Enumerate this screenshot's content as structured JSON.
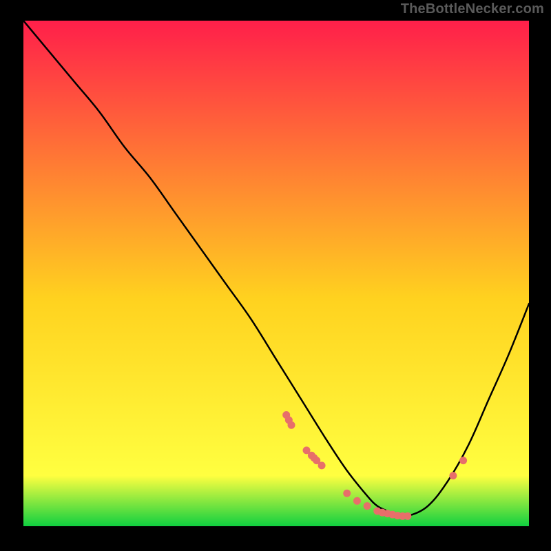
{
  "watermark": "TheBottleNecker.com",
  "colors": {
    "black": "#000000",
    "curve": "#000000",
    "marker": "#e76f6a",
    "grad_top": "#ff1f4a",
    "grad_mid": "#ffd21f",
    "grad_bot1": "#ffff40",
    "grad_bot2": "#10d040"
  },
  "chart_data": {
    "type": "line",
    "title": "",
    "xlabel": "",
    "ylabel": "",
    "xlim": [
      0,
      100
    ],
    "ylim": [
      0,
      100
    ],
    "series": [
      {
        "name": "bottleneck-curve",
        "x": [
          0,
          5,
          10,
          15,
          20,
          25,
          30,
          35,
          40,
          45,
          50,
          55,
          60,
          64,
          68,
          70,
          72,
          74,
          76,
          80,
          84,
          88,
          92,
          96,
          100
        ],
        "y": [
          100,
          94,
          88,
          82,
          75,
          69,
          62,
          55,
          48,
          41,
          33,
          25,
          17,
          11,
          6,
          4,
          3,
          2,
          2,
          4,
          9,
          16,
          25,
          34,
          44
        ]
      }
    ],
    "markers": {
      "name": "highlighted-points",
      "x": [
        52,
        52.5,
        53,
        56,
        57,
        57.5,
        58,
        59,
        64,
        66,
        68,
        70,
        71,
        72,
        73,
        74,
        75,
        76,
        85,
        87
      ],
      "y": [
        22,
        21,
        20,
        15,
        14,
        13.5,
        13,
        12,
        6.5,
        5,
        4,
        3,
        2.7,
        2.5,
        2.3,
        2.1,
        2,
        2,
        10,
        13
      ]
    },
    "background_gradient_stops": [
      {
        "offset": 0.0,
        "color_key": "grad_top"
      },
      {
        "offset": 0.55,
        "color_key": "grad_mid"
      },
      {
        "offset": 0.9,
        "color_key": "grad_bot1"
      },
      {
        "offset": 1.0,
        "color_key": "grad_bot2"
      }
    ]
  }
}
